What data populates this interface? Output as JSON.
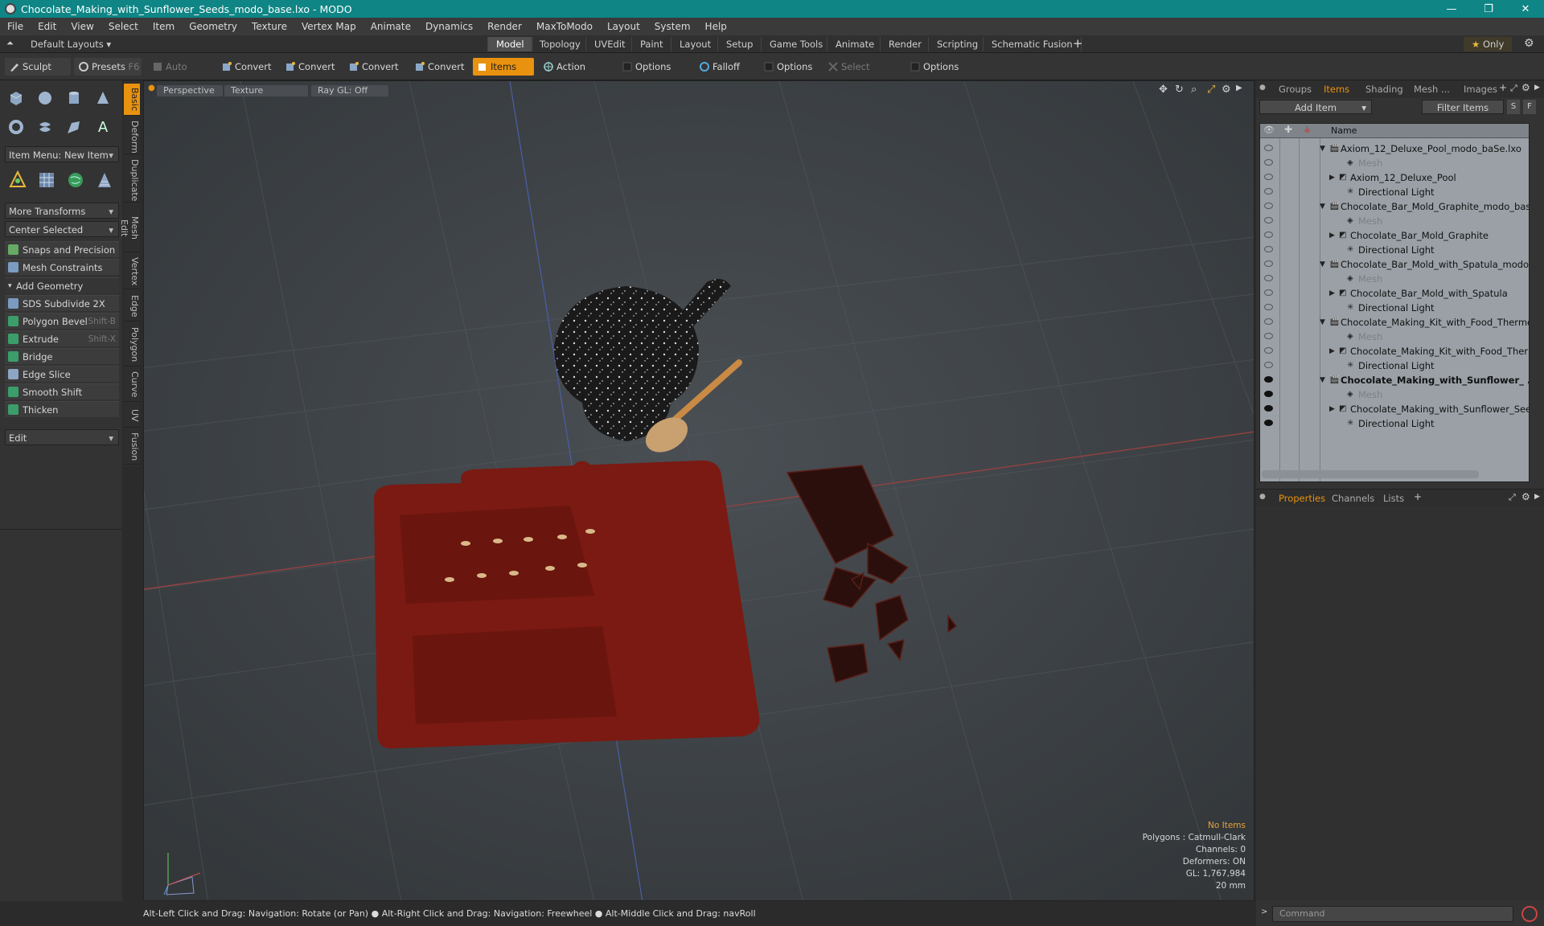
{
  "window": {
    "title": "Chocolate_Making_with_Sunflower_Seeds_modo_base.lxo - MODO"
  },
  "menu": [
    "File",
    "Edit",
    "View",
    "Select",
    "Item",
    "Geometry",
    "Texture",
    "Vertex Map",
    "Animate",
    "Dynamics",
    "Render",
    "MaxToModo",
    "Layout",
    "System",
    "Help"
  ],
  "layouts": {
    "default_label": "Default Layouts",
    "tabs": [
      "Model",
      "Topology",
      "UVEdit",
      "Paint",
      "Layout",
      "Setup",
      "Game Tools",
      "Animate",
      "Render",
      "Scripting",
      "Schematic Fusion"
    ],
    "active": "Model",
    "only_label": "Only"
  },
  "toolbar": {
    "sculpt": "Sculpt",
    "presets": "Presets",
    "presets_key": "F6",
    "auto_select": "Auto Select",
    "convert1": "Convert",
    "convert2": "Convert",
    "convert3": "Convert",
    "convert4": "Convert",
    "items": "Items",
    "action_center": "Action Center",
    "options1": "Options",
    "falloff": "Falloff",
    "options2": "Options",
    "select_through": "Select Through",
    "options3": "Options"
  },
  "left": {
    "item_menu": "Item Menu: New Item",
    "more_transforms": "More Transforms",
    "center_selected": "Center Selected",
    "snaps": "Snaps and Precision",
    "mesh_constraints": "Mesh Constraints",
    "add_geometry": "Add Geometry",
    "sds": "SDS Subdivide 2X",
    "polygon_bevel": "Polygon Bevel",
    "polygon_bevel_key": "Shift-B",
    "extrude": "Extrude",
    "extrude_key": "Shift-X",
    "bridge": "Bridge",
    "edge_slice": "Edge Slice",
    "smooth_shift": "Smooth Shift",
    "thicken": "Thicken",
    "edit": "Edit",
    "vtabs": [
      "Basic",
      "Deform",
      "Duplicate",
      "Mesh Edit",
      "Vertex",
      "Edge",
      "Polygon",
      "Curve",
      "UV",
      "Fusion"
    ]
  },
  "viewport": {
    "perspective": "Perspective",
    "texture": "Texture",
    "raygl": "Ray GL: Off",
    "info": {
      "items": "No Items",
      "polygons": "Polygons : Catmull-Clark",
      "channels": "Channels: 0",
      "deformers": "Deformers: ON",
      "gl": "GL: 1,767,984",
      "scale": "20 mm"
    }
  },
  "status": {
    "s1": "Alt-Left Click and Drag: Navigation: Rotate (or Pan)",
    "s2": "Alt-Right Click and Drag: Navigation: Freewheel",
    "s3": "Alt-Middle Click and Drag: navRoll"
  },
  "right": {
    "tabs": [
      "Groups",
      "Items",
      "Shading",
      "Mesh ...",
      "Images"
    ],
    "active_tab": "Items",
    "add_item": "Add Item",
    "filter_items": "Filter Items",
    "filter_s": "S",
    "filter_f": "F",
    "col_name": "Name",
    "rows": [
      {
        "label": "Axiom_12_Deluxe_Pool_modo_baSe.lxo",
        "level": 0,
        "kind": "scene"
      },
      {
        "label": "Mesh",
        "level": 2,
        "kind": "mesh"
      },
      {
        "label": "Axiom_12_Deluxe_Pool",
        "level": 1,
        "kind": "group"
      },
      {
        "label": "Directional Light",
        "level": 2,
        "kind": "light"
      },
      {
        "label": "Chocolate_Bar_Mold_Graphite_modo_base ...",
        "level": 0,
        "kind": "scene"
      },
      {
        "label": "Mesh",
        "level": 2,
        "kind": "mesh"
      },
      {
        "label": "Chocolate_Bar_Mold_Graphite",
        "level": 1,
        "kind": "group"
      },
      {
        "label": "Directional Light",
        "level": 2,
        "kind": "light"
      },
      {
        "label": "Chocolate_Bar_Mold_with_Spatula_modo_ ...",
        "level": 0,
        "kind": "scene"
      },
      {
        "label": "Mesh",
        "level": 2,
        "kind": "mesh"
      },
      {
        "label": "Chocolate_Bar_Mold_with_Spatula",
        "level": 1,
        "kind": "group"
      },
      {
        "label": "Directional Light",
        "level": 2,
        "kind": "light"
      },
      {
        "label": "Chocolate_Making_Kit_with_Food_Thermo ...",
        "level": 0,
        "kind": "scene"
      },
      {
        "label": "Mesh",
        "level": 2,
        "kind": "mesh"
      },
      {
        "label": "Chocolate_Making_Kit_with_Food_Ther ...",
        "level": 1,
        "kind": "group"
      },
      {
        "label": "Directional Light",
        "level": 2,
        "kind": "light"
      },
      {
        "label": "Chocolate_Making_with_Sunflower_ ...",
        "level": 0,
        "kind": "scene",
        "bold": true
      },
      {
        "label": "Mesh",
        "level": 2,
        "kind": "mesh"
      },
      {
        "label": "Chocolate_Making_with_Sunflower_Seeds",
        "level": 1,
        "kind": "group"
      },
      {
        "label": "Directional Light",
        "level": 2,
        "kind": "light"
      }
    ],
    "props_tabs": [
      "Properties",
      "Channels",
      "Lists"
    ],
    "props_active": "Properties",
    "command_placeholder": "Command"
  },
  "colors": {
    "accent": "#e8920f",
    "titlebar": "#0f8585"
  }
}
